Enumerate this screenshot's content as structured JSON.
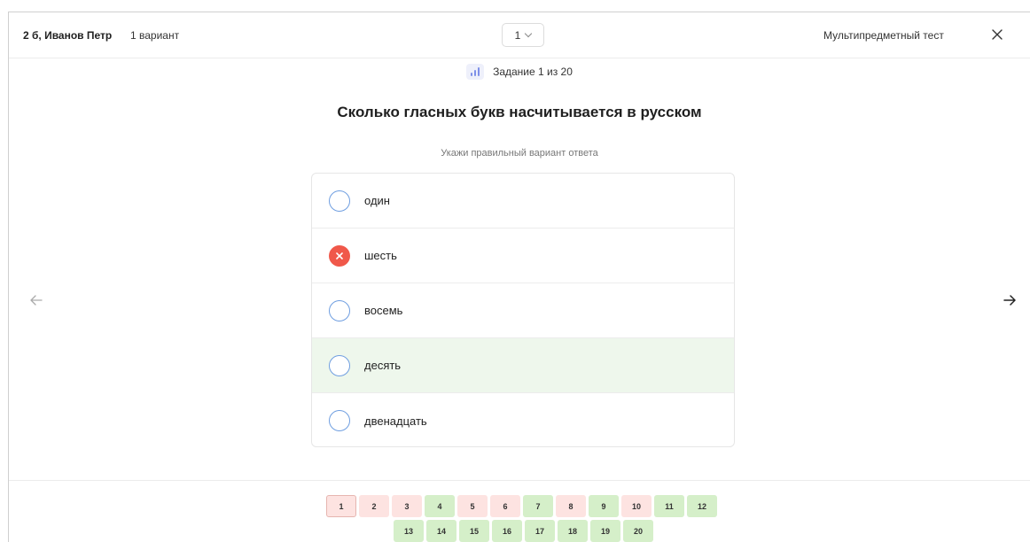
{
  "header": {
    "student": "2 б, Иванов Петр",
    "variant_label": "1 вариант",
    "variant_select_value": "1",
    "test_title": "Мультипредметный тест",
    "close_icon": "close-icon"
  },
  "task": {
    "icon": "chart-bars-icon",
    "progress_text": "Задание 1 из 20"
  },
  "question": {
    "text": "Сколько гласных букв насчитывается в русском",
    "hint": "Укажи правильный вариант ответа"
  },
  "answers": [
    {
      "label": "один",
      "state": "none"
    },
    {
      "label": "шесть",
      "state": "wrong"
    },
    {
      "label": "восемь",
      "state": "none"
    },
    {
      "label": "десять",
      "state": "correct"
    },
    {
      "label": "двенадцать",
      "state": "none"
    }
  ],
  "navigation": {
    "prev_icon": "arrow-left-icon",
    "next_icon": "arrow-right-icon"
  },
  "pager": {
    "row1": [
      {
        "n": "1",
        "status": "red",
        "current": true
      },
      {
        "n": "2",
        "status": "red"
      },
      {
        "n": "3",
        "status": "red"
      },
      {
        "n": "4",
        "status": "green"
      },
      {
        "n": "5",
        "status": "red"
      },
      {
        "n": "6",
        "status": "red"
      },
      {
        "n": "7",
        "status": "green"
      },
      {
        "n": "8",
        "status": "red"
      },
      {
        "n": "9",
        "status": "green"
      },
      {
        "n": "10",
        "status": "red"
      },
      {
        "n": "11",
        "status": "green"
      },
      {
        "n": "12",
        "status": "green"
      }
    ],
    "row2": [
      {
        "n": "13",
        "status": "green"
      },
      {
        "n": "14",
        "status": "green"
      },
      {
        "n": "15",
        "status": "green"
      },
      {
        "n": "16",
        "status": "green"
      },
      {
        "n": "17",
        "status": "green"
      },
      {
        "n": "18",
        "status": "green"
      },
      {
        "n": "19",
        "status": "green"
      },
      {
        "n": "20",
        "status": "green"
      }
    ]
  },
  "colors": {
    "wrong": "#f0584a",
    "correct_bg": "#eef7ec",
    "pager_red": "#fde3e1",
    "pager_green": "#d5efc9",
    "radio_border": "#6f9ee0"
  }
}
